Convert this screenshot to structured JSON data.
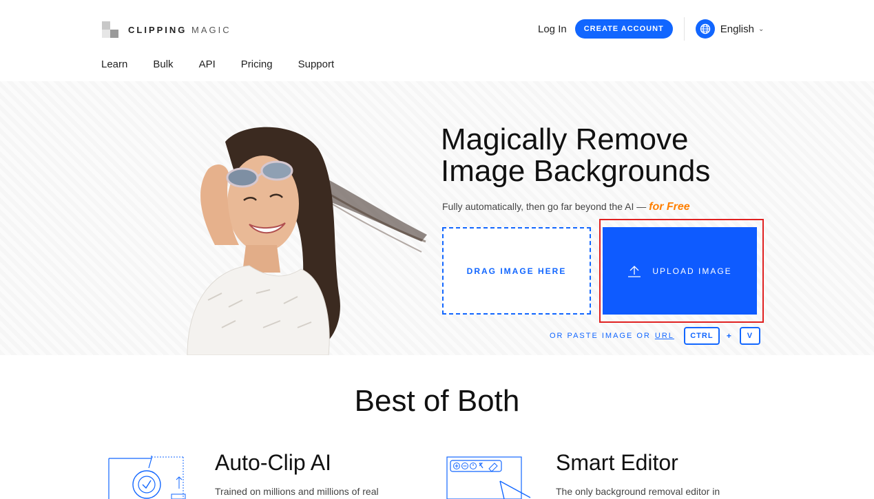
{
  "header": {
    "logo_bold": "CLIPPING",
    "logo_light": "MAGIC",
    "login_label": "Log In",
    "create_account_label": "CREATE ACCOUNT",
    "language_label": "English"
  },
  "nav": {
    "items": [
      {
        "label": "Learn"
      },
      {
        "label": "Bulk"
      },
      {
        "label": "API"
      },
      {
        "label": "Pricing"
      },
      {
        "label": "Support"
      }
    ]
  },
  "hero": {
    "title_line1": "Magically Remove",
    "title_line2": "Image Backgrounds",
    "subtitle": "Fully automatically, then go far beyond the AI — ",
    "subtitle_highlight": "for Free",
    "drag_label": "DRAG IMAGE HERE",
    "upload_label": "UPLOAD IMAGE",
    "paste_text": "OR PASTE IMAGE OR",
    "paste_url": "URL",
    "key_ctrl": "CTRL",
    "key_plus": "+",
    "key_v": "V"
  },
  "best": {
    "title": "Best of Both",
    "features": [
      {
        "title": "Auto-Clip AI",
        "desc": "Trained on millions and millions of real"
      },
      {
        "title": "Smart Editor",
        "desc": "The only background removal editor in"
      }
    ]
  },
  "colors": {
    "brand_blue": "#1166ff",
    "accent_orange": "#ff7f00",
    "highlight_red": "#e02020"
  }
}
